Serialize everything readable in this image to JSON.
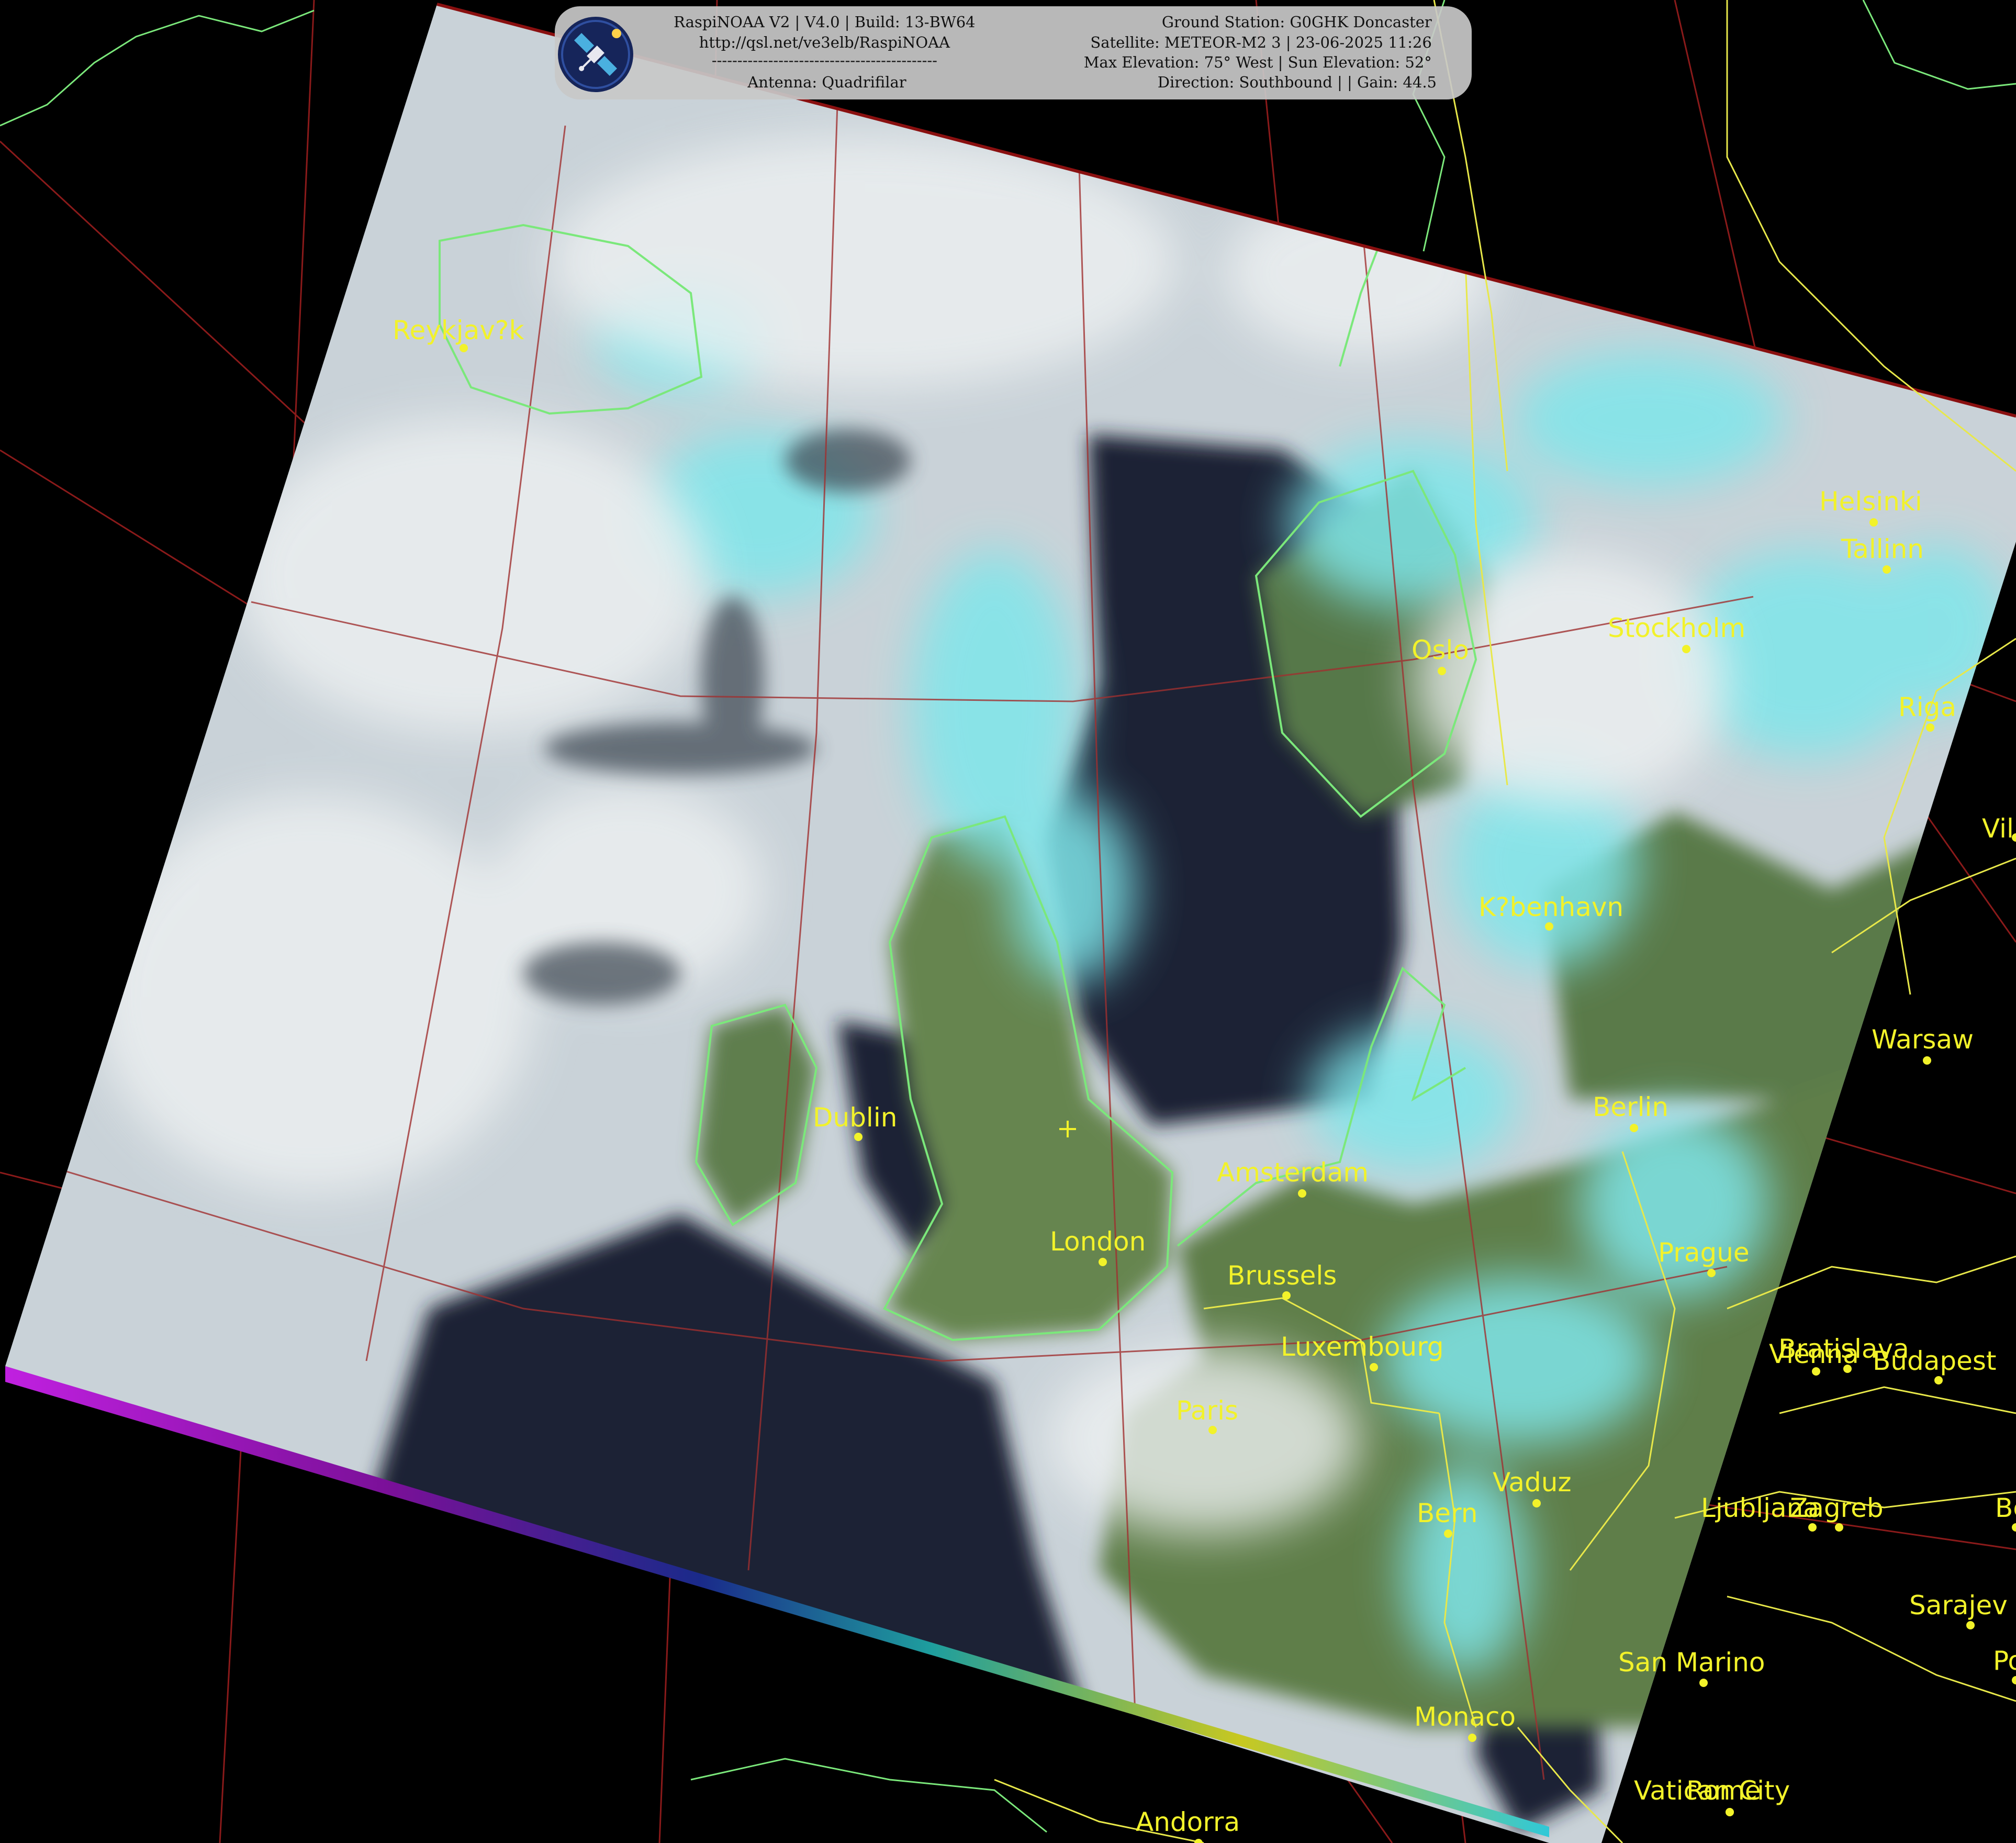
{
  "header": {
    "left_lines": [
      "RaspiNOAA V2 | V4.0 | Build: 13-BW64",
      "http://qsl.net/ve3elb/RaspiNOAA",
      "--------------------------------------------",
      "Antenna: Quadrifilar"
    ],
    "right_lines": [
      "Ground Station: G0GHK Doncaster",
      "Satellite: METEOR-M2 3 | 23-06-2025 11:26",
      "Max Elevation: 75° West | Sun Elevation: 52°",
      "Direction: Southbound | | Gain: 44.5"
    ],
    "logo_icon": "satellite-icon"
  },
  "colors": {
    "background": "#000000",
    "city_label": "#f2f22a",
    "border_yellow": "#e8e84a",
    "coast_green": "#7be87b",
    "graticule": "#b02020",
    "cloud": "#dfe6e8",
    "cloud_cyan": "#7fe6ea",
    "sea": "#1d2434",
    "land": "#5e7f4c"
  },
  "cities": [
    {
      "name": "Reykjav?k"
    },
    {
      "name": "Helsinki"
    },
    {
      "name": "Tallinn"
    },
    {
      "name": "Oslo"
    },
    {
      "name": "Stockholm"
    },
    {
      "name": "Riga"
    },
    {
      "name": "Viln"
    },
    {
      "name": "K?benhavn"
    },
    {
      "name": "Warsaw"
    },
    {
      "name": "Berlin"
    },
    {
      "name": "Dublin"
    },
    {
      "name": "Amsterdam"
    },
    {
      "name": "London"
    },
    {
      "name": "Prague"
    },
    {
      "name": "Brussels"
    },
    {
      "name": "Luxembourg"
    },
    {
      "name": "Bratislava"
    },
    {
      "name": "Vienna"
    },
    {
      "name": "Budapest"
    },
    {
      "name": "Paris"
    },
    {
      "name": "Vaduz"
    },
    {
      "name": "Bern"
    },
    {
      "name": "Ljubljana"
    },
    {
      "name": "Zagreb"
    },
    {
      "name": "Be"
    },
    {
      "name": "Sarajev"
    },
    {
      "name": "San Marino"
    },
    {
      "name": "Pod"
    },
    {
      "name": "Monaco"
    },
    {
      "name": "Vatican City"
    },
    {
      "name": "Rome"
    },
    {
      "name": "Andorra"
    }
  ]
}
